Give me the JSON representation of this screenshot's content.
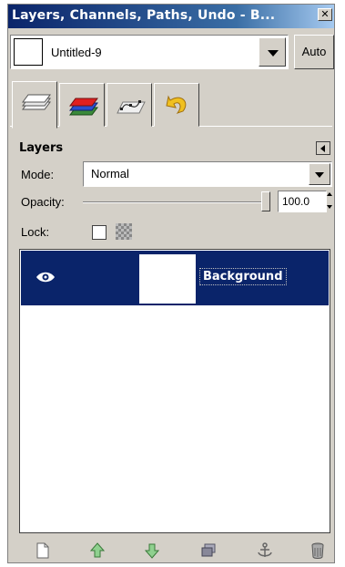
{
  "window": {
    "title": "Layers, Channels, Paths, Undo - B...",
    "close_glyph": "✕"
  },
  "image_selector": {
    "name": "Untitled-9",
    "auto_label": "Auto"
  },
  "tabs": [
    {
      "icon": "layers-tab-icon"
    },
    {
      "icon": "channels-tab-icon"
    },
    {
      "icon": "paths-tab-icon"
    },
    {
      "icon": "undo-tab-icon"
    }
  ],
  "panel": {
    "title": "Layers",
    "mode_label": "Mode:",
    "mode_value": "Normal",
    "opacity_label": "Opacity:",
    "opacity_value": "100.0",
    "opacity_fraction": 1.0,
    "lock_label": "Lock:"
  },
  "layers": [
    {
      "name": "Background",
      "visible": true,
      "selected": true
    }
  ],
  "colors": {
    "selection": "#0a246a",
    "dock_bg": "#d4d0c8"
  },
  "bottom_buttons": [
    "new-layer-icon",
    "raise-layer-icon",
    "lower-layer-icon",
    "duplicate-layer-icon",
    "anchor-layer-icon",
    "delete-layer-icon"
  ]
}
